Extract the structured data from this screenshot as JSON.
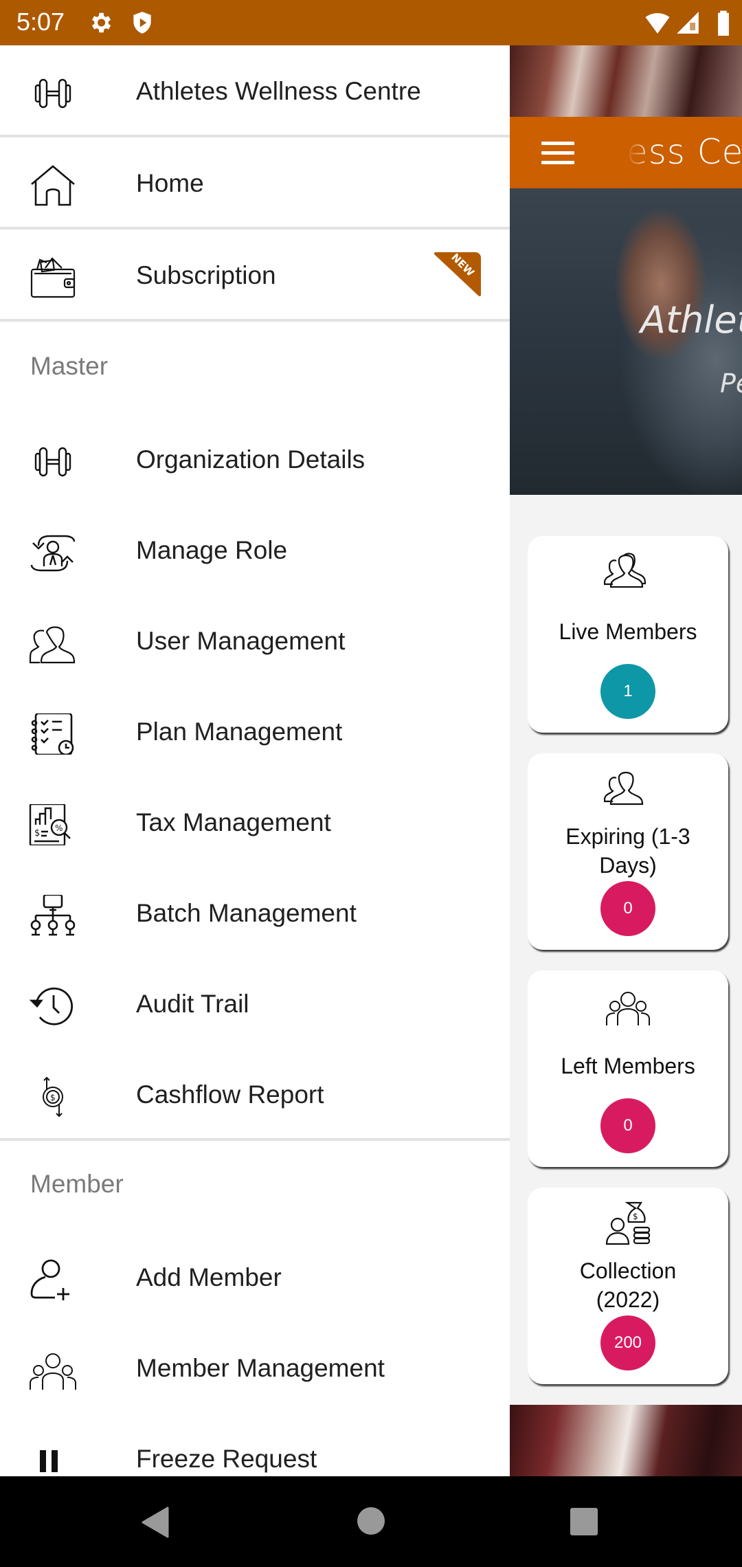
{
  "status_bar": {
    "time": "5:07",
    "left_icons": [
      "gear-icon",
      "shield-play-icon"
    ],
    "right_icons": [
      "wifi-icon",
      "cellular-signal-icon",
      "battery-icon"
    ],
    "color": "#ad5900"
  },
  "drawer": {
    "header": {
      "label": "Athletes Wellness Centre",
      "icon": "dumbbell-icon"
    },
    "top_items": [
      {
        "label": "Home",
        "icon": "home-icon"
      },
      {
        "label": "Subscription",
        "icon": "wallet-icon",
        "badge": "NEW"
      }
    ],
    "sections": [
      {
        "title": "Master",
        "items": [
          {
            "label": "Organization Details",
            "icon": "dumbbell-icon"
          },
          {
            "label": "Manage Role",
            "icon": "role-switch-icon"
          },
          {
            "label": "User Management",
            "icon": "users-icon"
          },
          {
            "label": "Plan Management",
            "icon": "plan-checklist-icon"
          },
          {
            "label": "Tax Management",
            "icon": "tax-report-icon"
          },
          {
            "label": "Batch Management",
            "icon": "hierarchy-icon"
          },
          {
            "label": "Audit Trail",
            "icon": "history-icon"
          },
          {
            "label": "Cashflow Report",
            "icon": "cashflow-icon"
          }
        ]
      },
      {
        "title": "Member",
        "items": [
          {
            "label": "Add Member",
            "icon": "add-user-icon"
          },
          {
            "label": "Member Management",
            "icon": "group-icon"
          },
          {
            "label": "Freeze Request",
            "icon": "pause-icon"
          }
        ]
      }
    ],
    "badge_color": "#b35a00"
  },
  "background_app": {
    "toolbar_title": "ess Cen",
    "toolbar_color": "#cc5f00",
    "hero_title": "Athlete",
    "hero_subtitle": "Pe",
    "stat_cards": [
      {
        "label": "Live Members",
        "value": "1",
        "badge_color": "#0e97a6",
        "icon": "users-icon"
      },
      {
        "label": "Expiring (1-3 Days)",
        "value": "0",
        "badge_color": "#d81b60",
        "icon": "users-icon"
      },
      {
        "label": "Left Members",
        "value": "0",
        "badge_color": "#d81b60",
        "icon": "group-icon"
      },
      {
        "label": "Collection (2022)",
        "value": "200",
        "badge_color": "#d81b60",
        "icon": "money-bag-icon"
      }
    ]
  },
  "nav_bar": {
    "buttons": [
      "back",
      "home",
      "recents"
    ]
  }
}
